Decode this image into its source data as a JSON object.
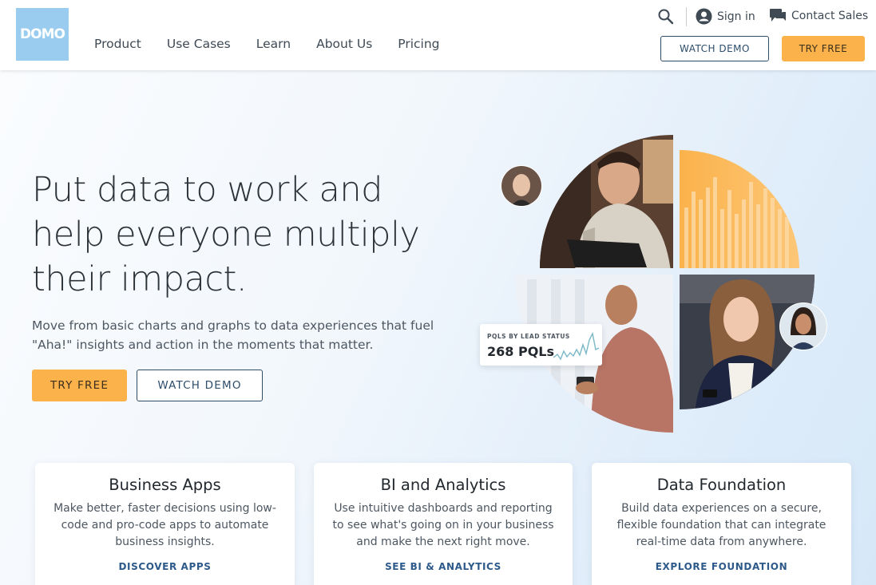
{
  "brand": {
    "logo_text": "DOMO",
    "logo_color": "#99ccee",
    "accent": "#fbb24b",
    "navy": "#2d4d6b"
  },
  "nav": {
    "items": [
      "Product",
      "Use Cases",
      "Learn",
      "About Us",
      "Pricing"
    ]
  },
  "utility": {
    "search_icon": "search-icon",
    "signin_label": "Sign in",
    "contact_label": "Contact Sales"
  },
  "header_buttons": {
    "watch_demo": "WATCH DEMO",
    "try_free": "TRY FREE"
  },
  "hero": {
    "headline": "Put data to work and help everyone multiply their impact.",
    "subline": "Move from basic charts and graphs to data experiences that fuel \"Aha!\" insights and action in the moments that matter.",
    "try_free": "TRY FREE",
    "watch_demo": "WATCH DEMO"
  },
  "stat_card": {
    "label": "PQLS BY LEAD STATUS",
    "value": "268 PQLs"
  },
  "cards": [
    {
      "title": "Business Apps",
      "body": "Make better, faster decisions using low-code and pro-code apps to automate business insights.",
      "link": "DISCOVER APPS"
    },
    {
      "title": "BI and Analytics",
      "body": "Use intuitive dashboards and reporting to see what's going on in your business and make the next right move.",
      "link": "SEE BI & ANALYTICS"
    },
    {
      "title": "Data Foundation",
      "body": "Build data experiences on a secure, flexible foundation that can integrate real-time data from anywhere.",
      "link": "EXPLORE FOUNDATION"
    }
  ]
}
